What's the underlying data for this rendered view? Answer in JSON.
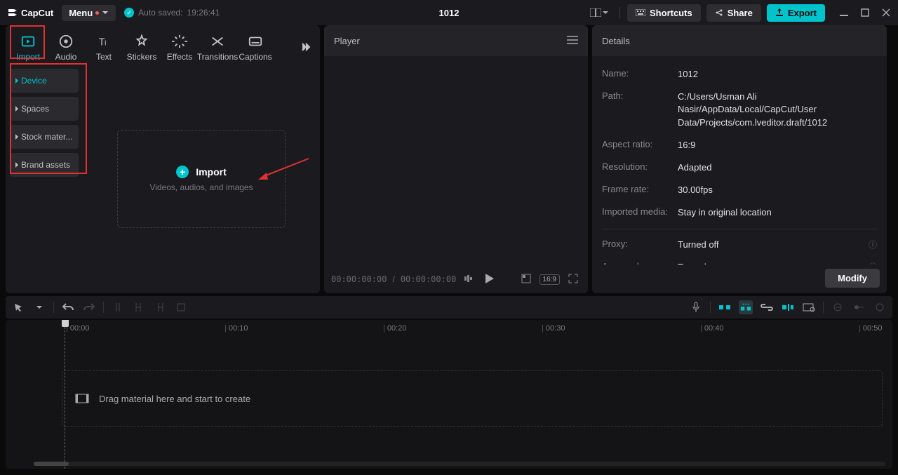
{
  "app_name": "CapCut",
  "menu_label": "Menu",
  "autosave": {
    "label": "Auto saved:",
    "time": "19:26:41"
  },
  "project_title": "1012",
  "titlebar": {
    "shortcuts": "Shortcuts",
    "share": "Share",
    "export": "Export"
  },
  "tabs": [
    "Import",
    "Audio",
    "Text",
    "Stickers",
    "Effects",
    "Transitions",
    "Captions"
  ],
  "sidebar_items": [
    "Device",
    "Spaces",
    "Stock mater...",
    "Brand assets"
  ],
  "dropzone": {
    "title": "Import",
    "sub": "Videos, audios, and images"
  },
  "player": {
    "title": "Player",
    "time_current": "00:00:00:00",
    "time_total": "00:00:00:00",
    "ratio_badge": "16:9"
  },
  "details": {
    "title": "Details",
    "rows": {
      "name_k": "Name:",
      "name_v": "1012",
      "path_k": "Path:",
      "path_v": "C:/Users/Usman Ali Nasir/AppData/Local/CapCut/User Data/Projects/com.lveditor.draft/1012",
      "aspect_k": "Aspect ratio:",
      "aspect_v": "16:9",
      "res_k": "Resolution:",
      "res_v": "Adapted",
      "fps_k": "Frame rate:",
      "fps_v": "30.00fps",
      "imp_k": "Imported media:",
      "imp_v": "Stay in original location",
      "proxy_k": "Proxy:",
      "proxy_v": "Turned off",
      "layers_k": "Arrange layers",
      "layers_v": "Turned on"
    },
    "modify": "Modify"
  },
  "timeline": {
    "ticks": [
      "00:00",
      "00:10",
      "00:20",
      "00:30",
      "00:40",
      "00:50"
    ],
    "drag_hint": "Drag material here and start to create"
  }
}
